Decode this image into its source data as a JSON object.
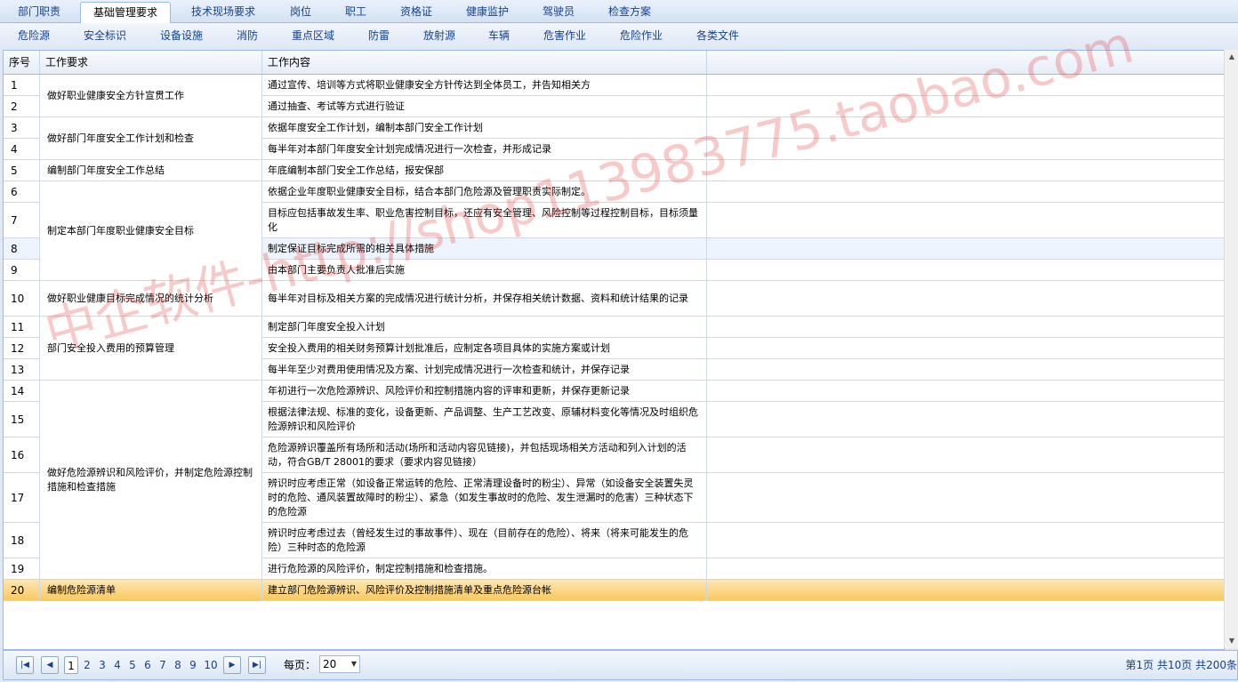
{
  "tabs_top": [
    "部门职责",
    "基础管理要求",
    "技术现场要求",
    "岗位",
    "职工",
    "资格证",
    "健康监护",
    "驾驶员",
    "检查方案"
  ],
  "tabs_sub": [
    "危险源",
    "安全标识",
    "设备设施",
    "消防",
    "重点区域",
    "防雷",
    "放射源",
    "车辆",
    "危害作业",
    "危险作业",
    "各类文件"
  ],
  "columns": {
    "idx": "序号",
    "req": "工作要求",
    "content": "工作内容"
  },
  "rows": [
    {
      "idx": "1",
      "content": "通过宣传、培训等方式将职业健康安全方针传达到全体员工，并告知相关方"
    },
    {
      "idx": "2",
      "content": "通过抽查、考试等方式进行验证"
    },
    {
      "idx": "3",
      "content": "依据年度安全工作计划，编制本部门安全工作计划"
    },
    {
      "idx": "4",
      "content": "每半年对本部门年度安全计划完成情况进行一次检查，并形成记录"
    },
    {
      "idx": "5",
      "content": "年底编制本部门安全工作总结，报安保部"
    },
    {
      "idx": "6",
      "content": "依据企业年度职业健康安全目标，结合本部门危险源及管理职责实际制定。"
    },
    {
      "idx": "7",
      "content": "目标应包括事故发生率、职业危害控制目标，还应有安全管理、风险控制等过程控制目标，目标须量化"
    },
    {
      "idx": "8",
      "content": "制定保证目标完成所需的相关具体措施"
    },
    {
      "idx": "9",
      "content": "由本部门主要负责人批准后实施"
    },
    {
      "idx": "10",
      "content": "每半年对目标及相关方案的完成情况进行统计分析，并保存相关统计数据、资料和统计结果的记录"
    },
    {
      "idx": "11",
      "content": "制定部门年度安全投入计划"
    },
    {
      "idx": "12",
      "content": "安全投入费用的相关财务预算计划批准后，应制定各项目具体的实施方案或计划"
    },
    {
      "idx": "13",
      "content": "每半年至少对费用使用情况及方案、计划完成情况进行一次检查和统计，并保存记录"
    },
    {
      "idx": "14",
      "content": "年初进行一次危险源辨识、风险评价和控制措施内容的评审和更新，并保存更新记录"
    },
    {
      "idx": "15",
      "content": "根据法律法规、标准的变化，设备更新、产品调整、生产工艺改变、原辅材料变化等情况及时组织危险源辨识和风险评价"
    },
    {
      "idx": "16",
      "content": "危险源辨识覆盖所有场所和活动(场所和活动内容见链接)，并包括现场相关方活动和列入计划的活动，符合GB/T 28001的要求（要求内容见链接）"
    },
    {
      "idx": "17",
      "content": "辨识时应考虑正常（如设备正常运转的危险、正常清理设备时的粉尘）、异常（如设备安全装置失灵时的危险、通风装置故障时的粉尘）、紧急（如发生事故时的危险、发生泄漏时的危害）三种状态下的危险源"
    },
    {
      "idx": "18",
      "content": "辨识时应考虑过去（曾经发生过的事故事件）、现在（目前存在的危险）、将来（将来可能发生的危险）三种时态的危险源"
    },
    {
      "idx": "19",
      "content": "进行危险源的风险评价，制定控制措施和检查措施。"
    },
    {
      "idx": "20",
      "content": "建立部门危险源辨识、风险评价及控制措施清单及重点危险源台帐"
    }
  ],
  "requirements": [
    "做好职业健康安全方针宣贯工作",
    "做好部门年度安全工作计划和检查",
    "编制部门年度安全工作总结",
    "制定本部门年度职业健康安全目标",
    "做好职业健康目标完成情况的统计分析",
    "部门安全投入费用的预算管理",
    "做好危险源辨识和风险评价，并制定危险源控制措施和检查措施",
    "编制危险源清单"
  ],
  "pager": {
    "pages": [
      "1",
      "2",
      "3",
      "4",
      "5",
      "6",
      "7",
      "8",
      "9",
      "10"
    ],
    "per_page_label": "每页：",
    "per_page_value": "20",
    "info": "第1页  共10页  共200条"
  },
  "watermark": "中企软件-http://shop113983775.taobao.com",
  "colors": {
    "accent": "#99bbe8",
    "selected": "#f9c85c",
    "alt_row": "#eef4fd"
  }
}
